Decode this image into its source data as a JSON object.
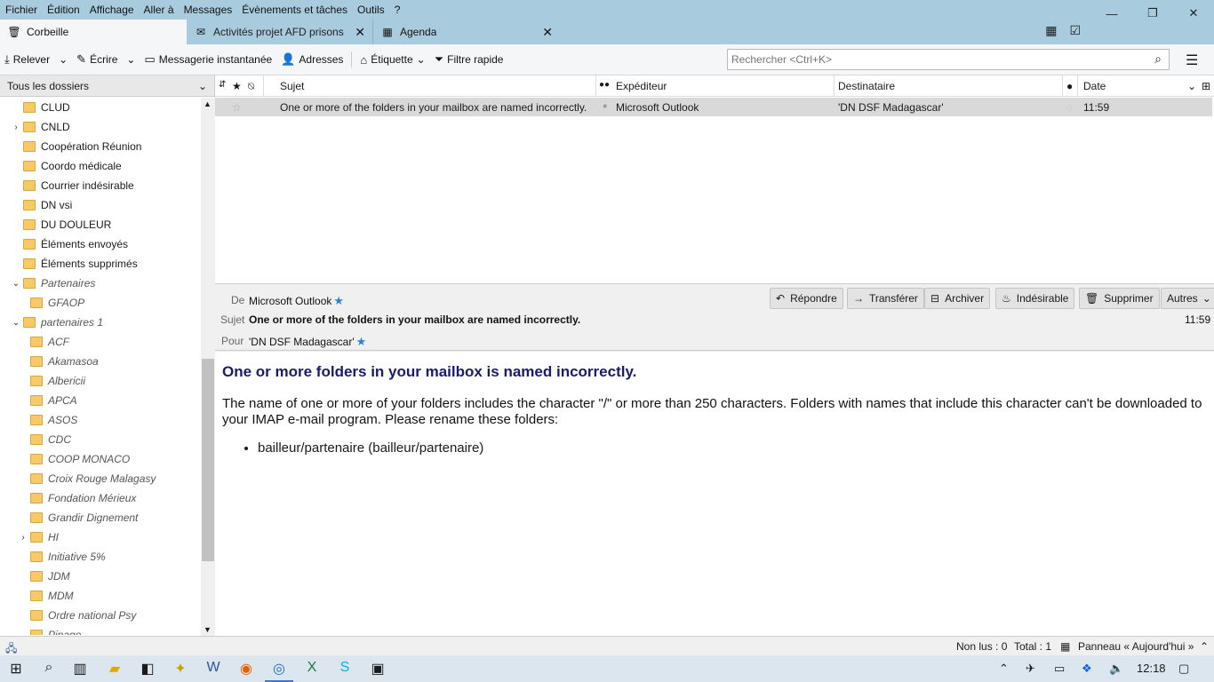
{
  "menu": [
    "Fichier",
    "Édition",
    "Affichage",
    "Aller à",
    "Messages",
    "Évènements et tâches",
    "Outils",
    "?"
  ],
  "window_controls": {
    "minimize": "—",
    "restore": "❐",
    "close": "✕"
  },
  "tabs": [
    {
      "label": "Corbeille",
      "icon": "trash-icon"
    },
    {
      "label": "Activités projet AFD prisons",
      "icon": "mail-icon"
    },
    {
      "label": "Agenda",
      "icon": "calendar-icon"
    }
  ],
  "toolbar": {
    "get_mail": "Relever",
    "write": "Écrire",
    "chat": "Messagerie instantanée",
    "address_book": "Adresses",
    "tag": "Étiquette",
    "quick_filter": "Filtre rapide",
    "search_placeholder": "Rechercher <Ctrl+K>"
  },
  "folder_pane": {
    "selector": "Tous les dossiers",
    "folders": [
      {
        "name": "CLUD",
        "level": 0,
        "twisty": "",
        "italic": false
      },
      {
        "name": "CNLD",
        "level": 0,
        "twisty": "›",
        "italic": false
      },
      {
        "name": "Coopération Réunion",
        "level": 0,
        "twisty": "",
        "italic": false
      },
      {
        "name": "Coordo médicale",
        "level": 0,
        "twisty": "",
        "italic": false
      },
      {
        "name": "Courrier indésirable",
        "level": 0,
        "twisty": "",
        "italic": false
      },
      {
        "name": "DN vsi",
        "level": 0,
        "twisty": "",
        "italic": false
      },
      {
        "name": "DU DOULEUR",
        "level": 0,
        "twisty": "",
        "italic": false
      },
      {
        "name": "Éléments envoyés",
        "level": 0,
        "twisty": "",
        "italic": false
      },
      {
        "name": "Éléments supprimés",
        "level": 0,
        "twisty": "",
        "italic": false
      },
      {
        "name": "Partenaires",
        "level": 0,
        "twisty": "⌄",
        "italic": true
      },
      {
        "name": "GFAOP",
        "level": 1,
        "twisty": "",
        "italic": true
      },
      {
        "name": "partenaires 1",
        "level": 0,
        "twisty": "⌄",
        "italic": true
      },
      {
        "name": "ACF",
        "level": 1,
        "twisty": "",
        "italic": true
      },
      {
        "name": "Akamasoa",
        "level": 1,
        "twisty": "",
        "italic": true
      },
      {
        "name": "Albericii",
        "level": 1,
        "twisty": "",
        "italic": true
      },
      {
        "name": "APCA",
        "level": 1,
        "twisty": "",
        "italic": true
      },
      {
        "name": "ASOS",
        "level": 1,
        "twisty": "",
        "italic": true
      },
      {
        "name": "CDC",
        "level": 1,
        "twisty": "",
        "italic": true
      },
      {
        "name": "COOP MONACO",
        "level": 1,
        "twisty": "",
        "italic": true
      },
      {
        "name": "Croix Rouge Malagasy",
        "level": 1,
        "twisty": "",
        "italic": true
      },
      {
        "name": "Fondation Mérieux",
        "level": 1,
        "twisty": "",
        "italic": true
      },
      {
        "name": "Grandir Dignement",
        "level": 1,
        "twisty": "",
        "italic": true
      },
      {
        "name": "HI",
        "level": 1,
        "twisty": "›",
        "italic": true
      },
      {
        "name": "Initiative 5%",
        "level": 1,
        "twisty": "",
        "italic": true
      },
      {
        "name": "JDM",
        "level": 1,
        "twisty": "",
        "italic": true
      },
      {
        "name": "MDM",
        "level": 1,
        "twisty": "",
        "italic": true
      },
      {
        "name": "Ordre national Psy",
        "level": 1,
        "twisty": "",
        "italic": true
      },
      {
        "name": "Pinage",
        "level": 1,
        "twisty": "",
        "italic": true
      }
    ]
  },
  "thread": {
    "columns": {
      "subject": "Sujet",
      "sender": "Expéditeur",
      "recipient": "Destinataire",
      "date": "Date"
    },
    "message": {
      "subject": "One or more of the folders in your mailbox are named incorrectly.",
      "sender": "Microsoft Outlook",
      "recipient": "'DN DSF Madagascar'",
      "date": "11:59"
    }
  },
  "header": {
    "from_label": "De",
    "from": "Microsoft Outlook",
    "subject_label": "Sujet",
    "subject": "One or more of the folders in your mailbox are named incorrectly.",
    "to_label": "Pour",
    "to": "'DN DSF Madagascar'",
    "time": "11:59",
    "buttons": {
      "reply": "Répondre",
      "forward": "Transférer",
      "archive": "Archiver",
      "junk": "Indésirable",
      "delete": "Supprimer",
      "more": "Autres"
    }
  },
  "body": {
    "heading": "One or more folders in your mailbox is named incorrectly.",
    "paragraph": "The name of one or more of your folders includes the character \"/\" or more than 250 characters. Folders with names that include this character can't be downloaded to your IMAP e-mail program. Please rename these folders:",
    "list": [
      "bailleur/partenaire (bailleur/partenaire)"
    ]
  },
  "statusbar": {
    "unread": "Non lus : 0",
    "total": "Total : 1",
    "today_pane": "Panneau « Aujourd'hui »"
  },
  "taskbar": {
    "time": "12:18"
  },
  "colors": {
    "titlebar": "#a9cbde",
    "selected_row": "#d9d9d9",
    "star": "#2a82da",
    "heading": "#1a1a6e"
  }
}
